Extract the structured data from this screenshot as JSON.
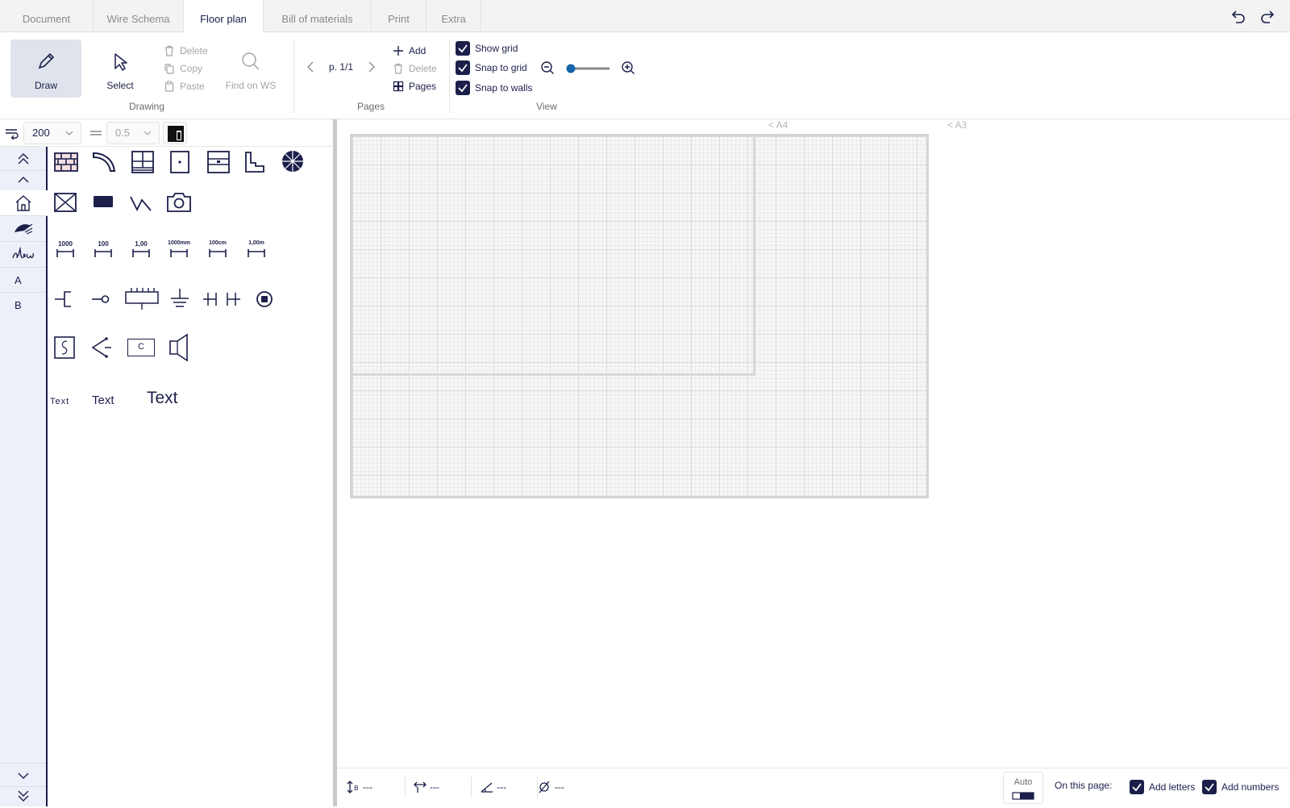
{
  "tabs": [
    {
      "label": "Document",
      "active": false
    },
    {
      "label": "Wire Schema",
      "active": false
    },
    {
      "label": "Floor plan",
      "active": true
    },
    {
      "label": "Bill of materials",
      "active": false
    },
    {
      "label": "Print",
      "active": false
    },
    {
      "label": "Extra",
      "active": false
    }
  ],
  "ribbon": {
    "drawing": {
      "draw_label": "Draw",
      "select_label": "Select",
      "delete_label": "Delete",
      "copy_label": "Copy",
      "paste_label": "Paste",
      "find_label": "Find on WS",
      "group_label": "Drawing"
    },
    "pages": {
      "page_indicator": "p. 1/1",
      "add_label": "Add",
      "delete_label": "Delete",
      "pages_label": "Pages",
      "group_label": "Pages"
    },
    "view": {
      "show_grid_label": "Show grid",
      "snap_grid_label": "Snap to grid",
      "snap_walls_label": "Snap to walls",
      "show_grid": true,
      "snap_grid": true,
      "snap_walls": true,
      "zoom_level": 0.0,
      "group_label": "View"
    }
  },
  "options": {
    "scale_value": "200",
    "line_width_value": "0.5"
  },
  "sidebar": {
    "letter_a": "A",
    "letter_b": "B"
  },
  "symbols": {
    "scales": [
      "1000",
      "100",
      "1,00",
      "1000mm",
      "100cm",
      "1,00m"
    ],
    "text_samples": [
      "Text",
      "Text",
      "Text"
    ],
    "socket_letter": "C"
  },
  "canvas": {
    "a4_label": "< A4",
    "a3_label": "< A3"
  },
  "statusbar": {
    "length_value": "---",
    "width_value": "---",
    "angle_value": "---",
    "diameter_value": "---",
    "auto_label": "Auto",
    "on_page_label": "On this page:",
    "add_letters_label": "Add letters",
    "add_numbers_label": "Add numbers",
    "add_letters": true,
    "add_numbers": true
  },
  "colors": {
    "accent": "#1b1f4a",
    "slider_knob": "#1565a8"
  }
}
